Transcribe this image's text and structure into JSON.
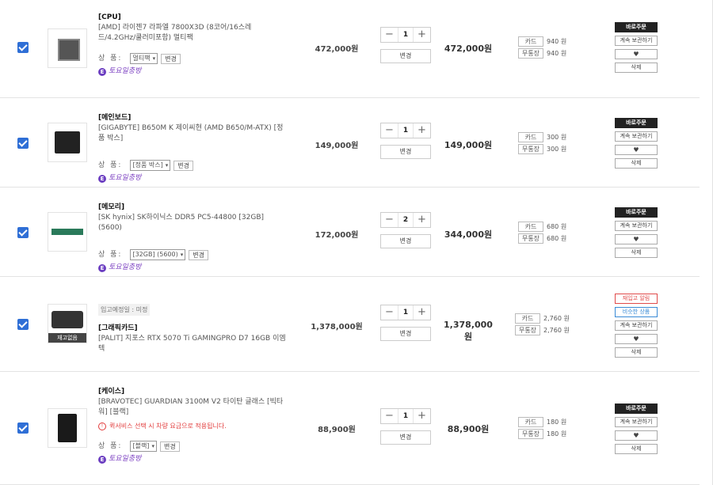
{
  "items": [
    {
      "category": "[CPU]",
      "name": "[AMD] 라이젠7 라파엘 7800X3D (8코어/16스레드/4.2GHz/쿨러미포함) 멀티팩",
      "option_label": "상 품:",
      "option_value": "멀티팩",
      "option_change": "변경",
      "coupon": "토요일충방",
      "unit_price": "472,000원",
      "quantity": "1",
      "quantity_change": "변경",
      "total_price": "472,000원",
      "points": [
        {
          "type": "카드",
          "value": "940 원"
        },
        {
          "type": "무통장",
          "value": "940 원"
        }
      ],
      "actions": {
        "buy": "바로주문",
        "save": "계속 보관하기",
        "heart": "♥",
        "delete": "삭제"
      }
    },
    {
      "category": "[메인보드]",
      "name": "[GIGABYTE] B650M K 제이씨현 (AMD B650/M-ATX) [정품 박스]",
      "option_label": "상 품:",
      "option_value": "[정품 박스]",
      "option_change": "변경",
      "coupon": "토요일충방",
      "unit_price": "149,000원",
      "quantity": "1",
      "quantity_change": "변경",
      "total_price": "149,000원",
      "points": [
        {
          "type": "카드",
          "value": "300 원"
        },
        {
          "type": "무통장",
          "value": "300 원"
        }
      ],
      "actions": {
        "buy": "바로주문",
        "save": "계속 보관하기",
        "heart": "♥",
        "delete": "삭제"
      }
    },
    {
      "category": "[메모리]",
      "name": "[SK hynix] SK하이닉스 DDR5 PC5-44800 [32GB] (5600)",
      "option_label": "상 품:",
      "option_value": "[32GB] (5600)",
      "option_change": "변경",
      "coupon": "토요일충방",
      "unit_price": "172,000원",
      "quantity": "2",
      "quantity_change": "변경",
      "total_price": "344,000원",
      "points": [
        {
          "type": "카드",
          "value": "680 원"
        },
        {
          "type": "무통장",
          "value": "680 원"
        }
      ],
      "actions": {
        "buy": "바로주문",
        "save": "계속 보관하기",
        "heart": "♥",
        "delete": "삭제"
      }
    },
    {
      "stock_note": "입고예정일 : 미정",
      "soldout": "재고없음",
      "category": "[그래픽카드]",
      "name": "[PALIT] 지포스 RTX 5070 Ti GAMINGPRO D7 16GB 이엠텍",
      "unit_price": "1,378,000원",
      "quantity": "1",
      "quantity_change": "변경",
      "total_price": "1,378,000원",
      "points": [
        {
          "type": "카드",
          "value": "2,760 원"
        },
        {
          "type": "무통장",
          "value": "2,760 원"
        }
      ],
      "actions": {
        "restock": "재입고 알림",
        "similar": "비슷한 상품",
        "save": "계속 보관하기",
        "heart": "♥",
        "delete": "삭제"
      }
    },
    {
      "category": "[케이스]",
      "name": "[BRAVOTEC] GUARDIAN 3100M V2 타이탄 글래스 [빅타워] [블랙]",
      "warning": "퀵서비스 선택 시 차량 요금으로 적용됩니다.",
      "option_label": "상 품:",
      "option_value": "[블랙]",
      "option_change": "변경",
      "coupon": "토요일충방",
      "unit_price": "88,900원",
      "quantity": "1",
      "quantity_change": "변경",
      "total_price": "88,900원",
      "points": [
        {
          "type": "카드",
          "value": "180 원"
        },
        {
          "type": "무통장",
          "value": "180 원"
        }
      ],
      "actions": {
        "buy": "바로주문",
        "save": "계속 보관하기",
        "heart": "♥",
        "delete": "삭제"
      }
    }
  ],
  "icons": {
    "checkbox": "checkbox-checked",
    "minus": "−",
    "plus": "+",
    "dropdown": "chevron-down-icon",
    "coupon": "coupon-icon",
    "warning": "info-icon"
  },
  "colors": {
    "checkbox": "#2f6fd6",
    "coupon": "#7b3fc1",
    "warning": "#e23b3b",
    "restock": "#e04a4a",
    "similar": "#3a8bd6",
    "buy": "#222222"
  }
}
